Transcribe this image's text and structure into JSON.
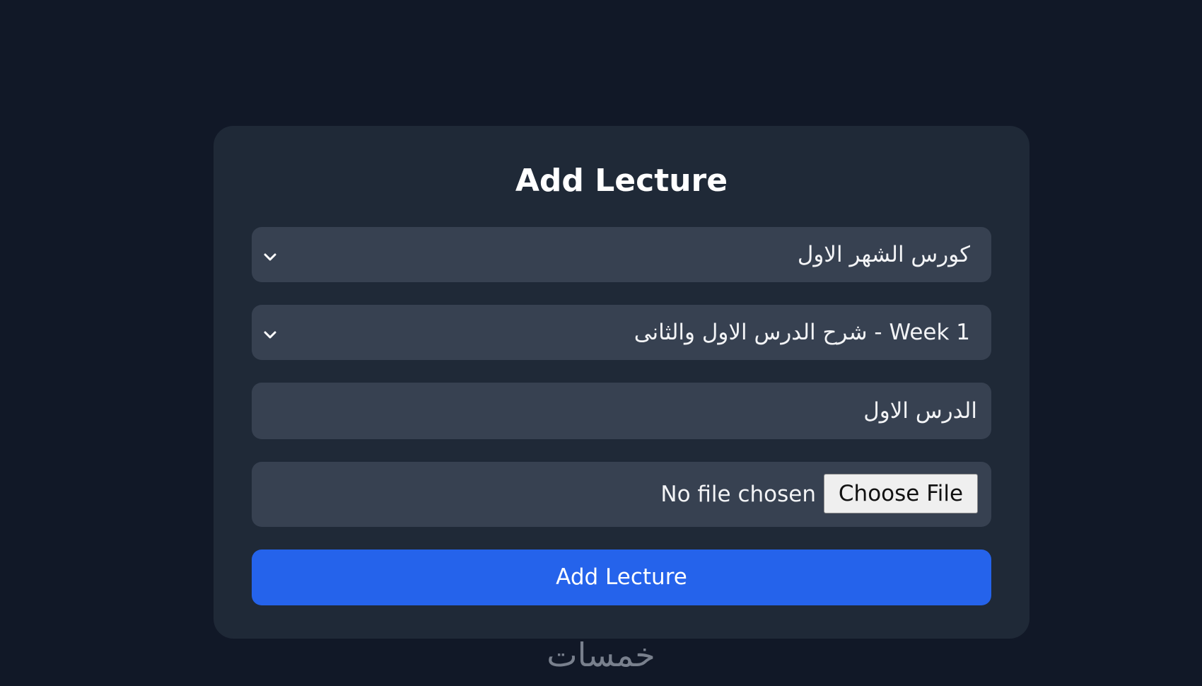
{
  "form": {
    "title": "Add Lecture",
    "course_select": {
      "selected": "كورس الشهر الاول"
    },
    "week_select": {
      "selected": "Week 1 - شرح الدرس الاول والثانى"
    },
    "lecture_name": {
      "value": "الدرس الاول"
    },
    "file_input": {
      "button_label": "Choose File",
      "status": "No file chosen"
    },
    "submit_label": "Add Lecture"
  },
  "watermark": {
    "text": "خمسات"
  },
  "colors": {
    "page_background": "#111827",
    "card_background": "#1f2937",
    "field_background": "#374151",
    "primary_button": "#2563eb"
  },
  "icons": {
    "select_indicator": "chevron-down-icon"
  }
}
